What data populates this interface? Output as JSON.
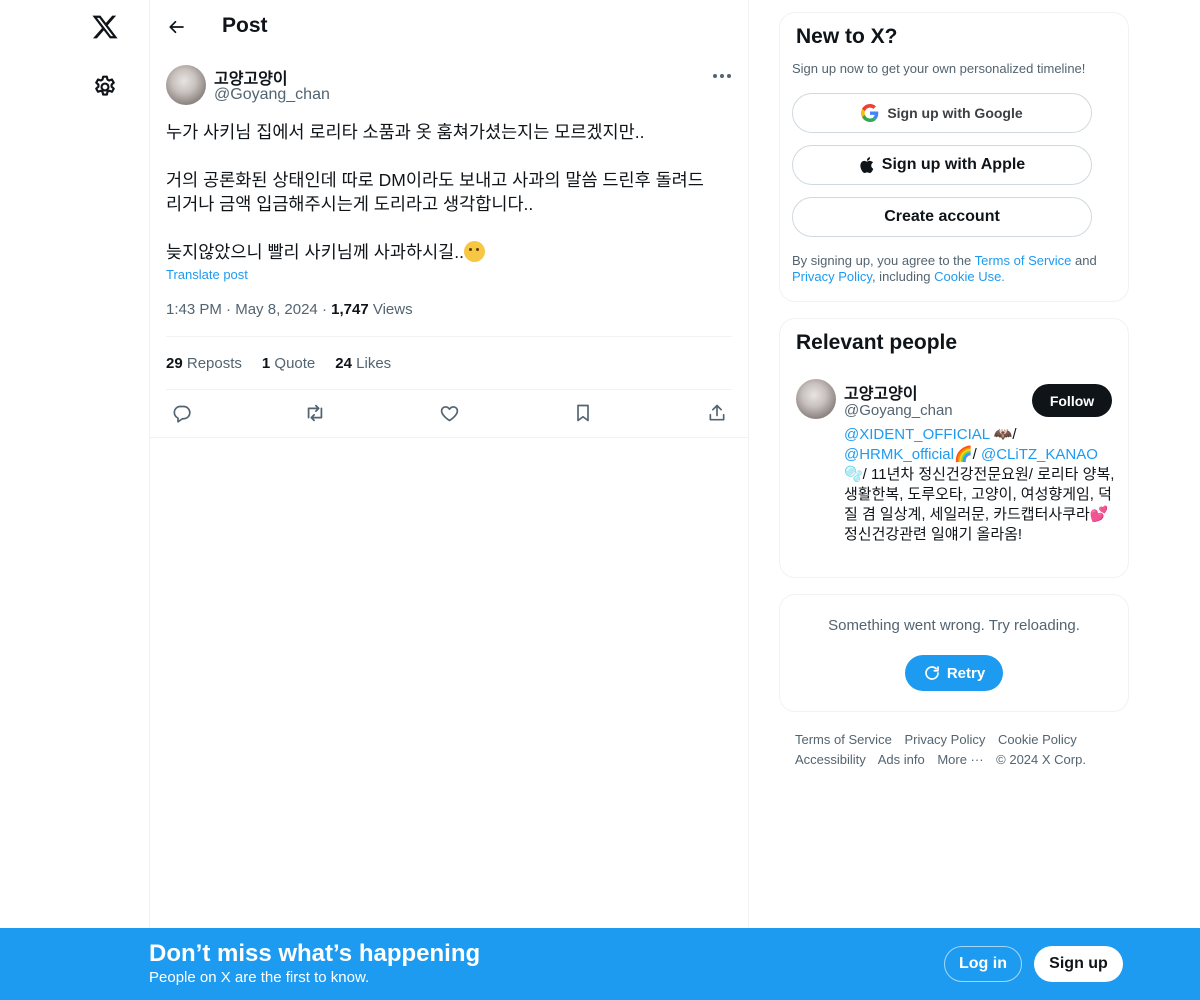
{
  "nav": {
    "logo_icon": "x-logo-icon",
    "settings_icon": "gear-icon"
  },
  "header": {
    "back_icon": "arrow-left-icon",
    "title": "Post"
  },
  "post": {
    "author_name": "고양고양이",
    "author_handle": "@Goyang_chan",
    "more_icon": "more-dots-icon",
    "lines": [
      "누가 사키님 집에서 로리타 소품과 옷 훔쳐가셨는지는 모르겠지만..",
      "",
      "거의 공론화된 상태인데 따로 DM이라도 보내고 사과의 말씀 드린후 돌려드",
      "리거나 금액 입금해주시는게 도리라고 생각합니다..",
      "",
      "늦지않았으니 빨리 사키님께 사과하시길.."
    ],
    "emoji": "tear-smile-emoji",
    "translate": "Translate post",
    "time": "1:43 PM",
    "dot": "·",
    "date": "May 8, 2024",
    "views_count": "1,747",
    "views_label": "Views",
    "reposts_count": "29",
    "reposts_label": "Reposts",
    "quote_count": "1",
    "quote_label": "Quote",
    "likes_count": "24",
    "likes_label": "Likes",
    "action_icons": [
      "reply-icon",
      "repost-icon",
      "like-icon",
      "bookmark-icon",
      "share-icon"
    ]
  },
  "signup_card": {
    "title": "New to X?",
    "subtitle": "Sign up now to get your own personalized timeline!",
    "google_label": "Sign up with Google",
    "apple_label": "Sign up with Apple",
    "create_label": "Create account",
    "legal_prefix": "By signing up, you agree to the ",
    "tos": "Terms of Service",
    "and": " and",
    "privacy": "Privacy Policy",
    "including": ", including ",
    "cookie": "Cookie Use."
  },
  "people_card": {
    "title": "Relevant people",
    "name": "고양고양이",
    "handle": "@Goyang_chan",
    "follow_label": "Follow",
    "bio_mention1": "@XIDENT_OFFICIAL",
    "bio_sep1": " 🦇/ ",
    "bio_mention2": "@HRMK_official",
    "bio_sep2": "🌈/ ",
    "bio_mention3": "@CLiTZ_KANAO",
    "bio_rest": " 🫧/ 11년차 정신건강전문요원/ 로리타 양복, 생활한복, 도루오타, 고양이, 여성향게임, 덕질 겸 일상계, 세일러문, 카드캡터사쿠라💕정신건강관련 일얘기 올라옴!"
  },
  "error_card": {
    "message": "Something went wrong. Try reloading.",
    "retry_label": "Retry"
  },
  "footer": {
    "links": [
      "Terms of Service",
      "Privacy Policy",
      "Cookie Policy",
      "Accessibility",
      "Ads info",
      "More ···",
      "© 2024 X Corp."
    ]
  },
  "banner": {
    "title": "Don’t miss what’s happening",
    "subtitle": "People on X are the first to know.",
    "login_label": "Log in",
    "signup_label": "Sign up"
  },
  "colors": {
    "accent": "#1d9bf0",
    "text": "#0f1419",
    "secondary": "#536471",
    "border": "#eff3f4"
  }
}
